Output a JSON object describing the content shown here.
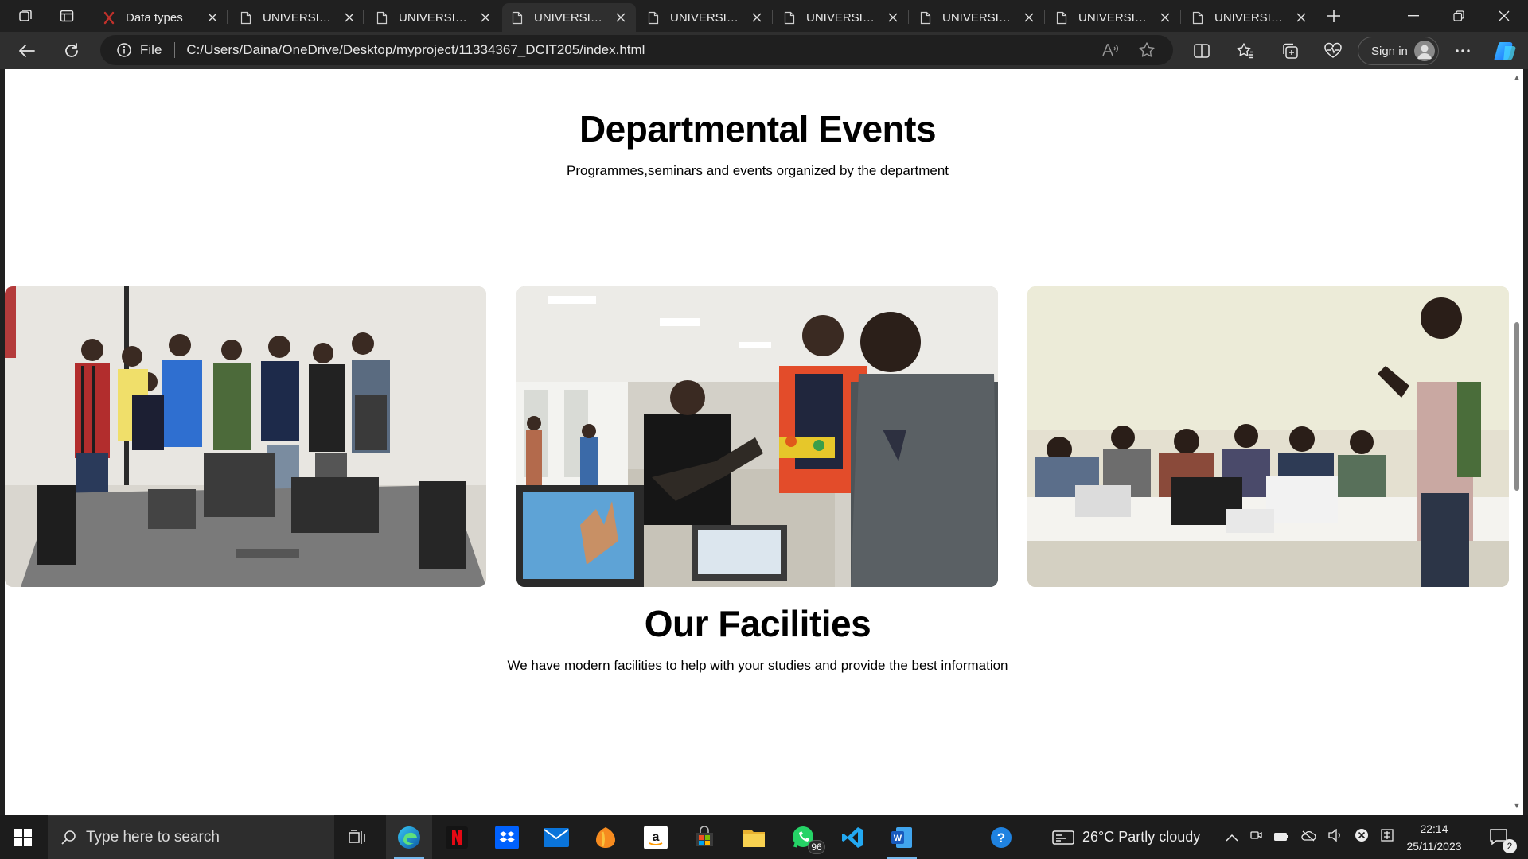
{
  "browser": {
    "tabs": [
      {
        "title": "Data types",
        "favicon": "brand-icon",
        "active": false
      },
      {
        "title": "UNIVERSITY OF GHANA",
        "favicon": "page-icon",
        "active": false
      },
      {
        "title": "UNIVERSITY OF GHANA",
        "favicon": "page-icon",
        "active": false
      },
      {
        "title": "UNIVERSITY OF GHANA",
        "favicon": "page-icon",
        "active": true
      },
      {
        "title": "UNIVERSITY OF GHANA",
        "favicon": "page-icon",
        "active": false
      },
      {
        "title": "UNIVERSITY OF GHANA",
        "favicon": "page-icon",
        "active": false
      },
      {
        "title": "UNIVERSITY OF GHANA",
        "favicon": "page-icon",
        "active": false
      },
      {
        "title": "UNIVERSITY OF GHANA",
        "favicon": "page-icon",
        "active": false
      },
      {
        "title": "UNIVERSITY OF GHANA",
        "favicon": "page-icon",
        "active": false
      }
    ],
    "address": {
      "scheme_label": "File",
      "url": "C:/Users/Daina/OneDrive/Desktop/myproject/11334367_DCIT205/index.html"
    },
    "signin_label": "Sign in"
  },
  "page": {
    "events": {
      "title": "Departmental Events",
      "subtitle": "Programmes,seminars and events organized by the department",
      "photos": [
        "group-photo",
        "lab-photo",
        "seminar-photo"
      ]
    },
    "facilities": {
      "title": "Our Facilities",
      "subtitle": "We have modern facilities to help with your studies and provide the best information"
    }
  },
  "taskbar": {
    "search_placeholder": "Type here to search",
    "apps": [
      "edge-icon",
      "netflix-icon",
      "dropbox-icon",
      "mail-icon",
      "fl-studio-icon",
      "amazon-icon",
      "store-icon",
      "file-explorer-icon",
      "whatsapp-icon",
      "vscode-icon",
      "word-icon"
    ],
    "whatsapp_badge": "96",
    "weather": "26°C  Partly cloudy",
    "time": "22:14",
    "date": "25/11/2023",
    "notification_count": "2"
  },
  "colors": {
    "accent": "#76b9ed",
    "page_bg": "#ffffff",
    "chrome_bg": "#202020"
  }
}
